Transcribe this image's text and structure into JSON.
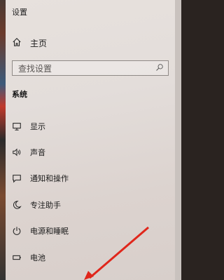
{
  "window": {
    "title": "设置"
  },
  "home": {
    "label": "主页",
    "icon": "home-icon"
  },
  "search": {
    "placeholder": "查找设置",
    "icon": "search-icon"
  },
  "section": {
    "title": "系统"
  },
  "nav": {
    "items": [
      {
        "label": "显示",
        "icon": "monitor-icon"
      },
      {
        "label": "声音",
        "icon": "speaker-icon"
      },
      {
        "label": "通知和操作",
        "icon": "notification-icon"
      },
      {
        "label": "专注助手",
        "icon": "moon-icon"
      },
      {
        "label": "电源和睡眠",
        "icon": "power-icon"
      },
      {
        "label": "电池",
        "icon": "battery-icon"
      }
    ]
  },
  "colors": {
    "panel": "#e3ddda",
    "annotation_arrow": "#e0261b"
  }
}
